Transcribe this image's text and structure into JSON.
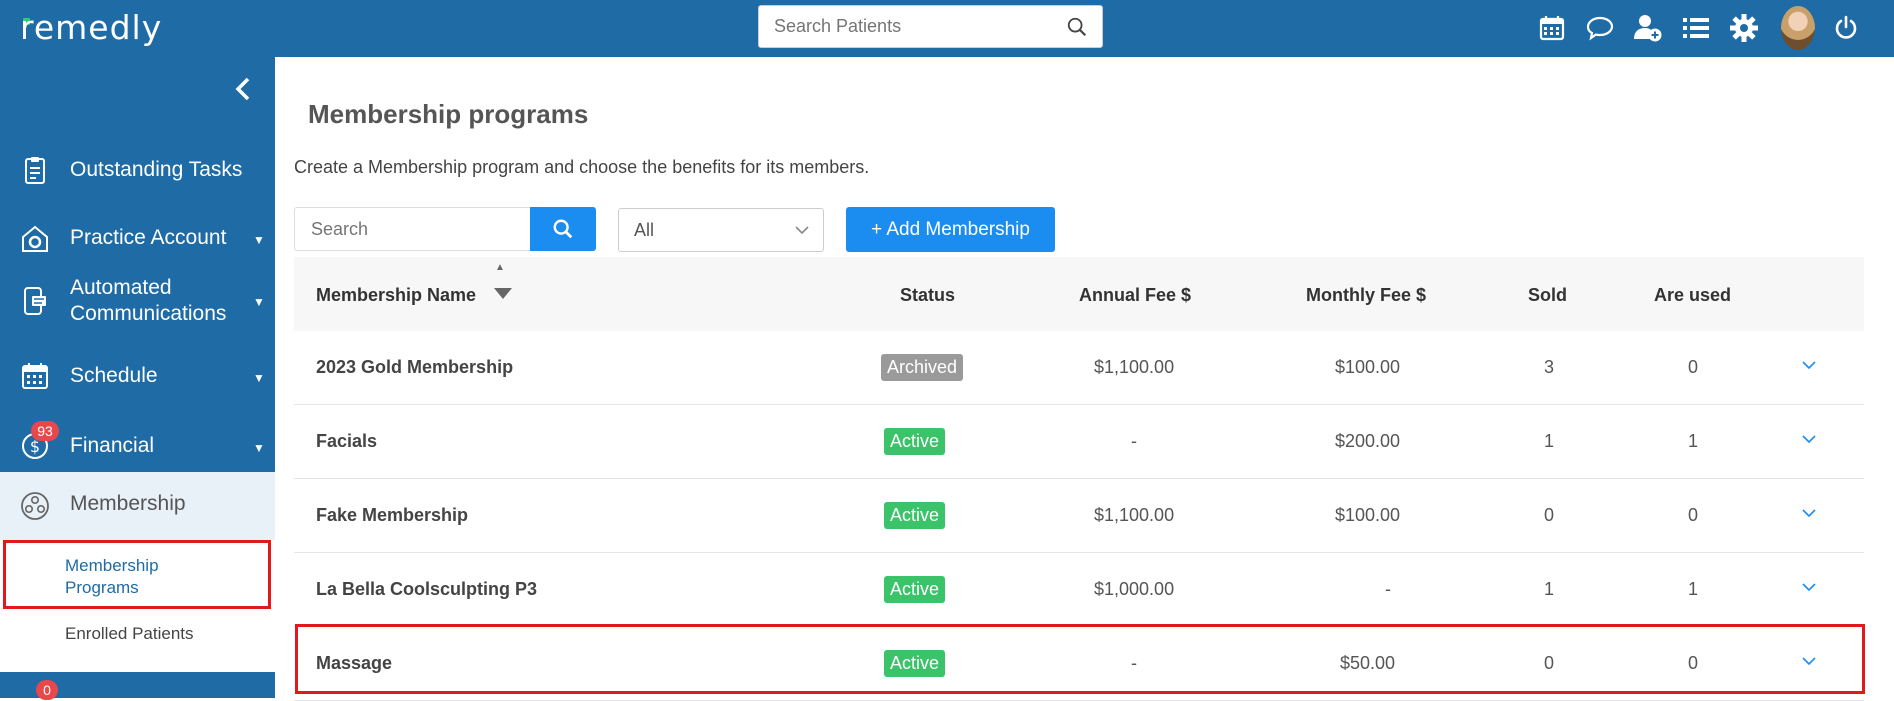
{
  "header": {
    "logo": "remedly",
    "search_placeholder": "Search Patients",
    "icons": [
      "calendar-icon",
      "chat-icon",
      "add-user-icon",
      "list-icon",
      "settings-gear-icon",
      "user-avatar",
      "power-icon"
    ]
  },
  "sidebar": {
    "items": [
      {
        "label": "Outstanding Tasks",
        "icon": "clipboard-icon"
      },
      {
        "label": "Practice Account",
        "icon": "practice-gear-icon"
      },
      {
        "label": "Automated Communications",
        "label_line1": "Automated",
        "label_line2": "Communications",
        "icon": "phone-icon"
      },
      {
        "label": "Schedule",
        "icon": "calendar-icon"
      },
      {
        "label": "Financial",
        "icon": "dollar-icon",
        "badge": "93"
      },
      {
        "label": "Membership",
        "icon": "membership-icon"
      }
    ],
    "sub_items": [
      {
        "label_line1": "Membership",
        "label_line2": "Programs"
      },
      {
        "label": "Enrolled Patients"
      }
    ],
    "bottom_badge": "0"
  },
  "main": {
    "title": "Membership programs",
    "description": "Create a Membership program and choose the benefits for its members.",
    "search_placeholder": "Search",
    "filter_value": "All",
    "add_button": "+ Add Membership",
    "table": {
      "headers": [
        "Membership Name",
        "Status",
        "Annual Fee $",
        "Monthly Fee $",
        "Sold",
        "Are used"
      ],
      "rows": [
        {
          "name": "2023 Gold Membership",
          "status": "Archived",
          "annual": "$1,100.00",
          "monthly": "$100.00",
          "sold": "3",
          "used": "0"
        },
        {
          "name": "Facials",
          "status": "Active",
          "annual": "-",
          "monthly": "$200.00",
          "sold": "1",
          "used": "1"
        },
        {
          "name": "Fake Membership",
          "status": "Active",
          "annual": "$1,100.00",
          "monthly": "$100.00",
          "sold": "0",
          "used": "0"
        },
        {
          "name": "La Bella Coolsculpting P3",
          "status": "Active",
          "annual": "$1,000.00",
          "monthly": "-",
          "sold": "1",
          "used": "1"
        },
        {
          "name": "Massage",
          "status": "Active",
          "annual": "-",
          "monthly": "$50.00",
          "sold": "0",
          "used": "0"
        }
      ]
    }
  },
  "colors": {
    "primary": "#1e6ba5",
    "accent": "#1b8cf0",
    "active": "#3bc36a",
    "archived": "#9a9a9a",
    "badge": "#e8474b",
    "highlight": "#e0191a"
  }
}
